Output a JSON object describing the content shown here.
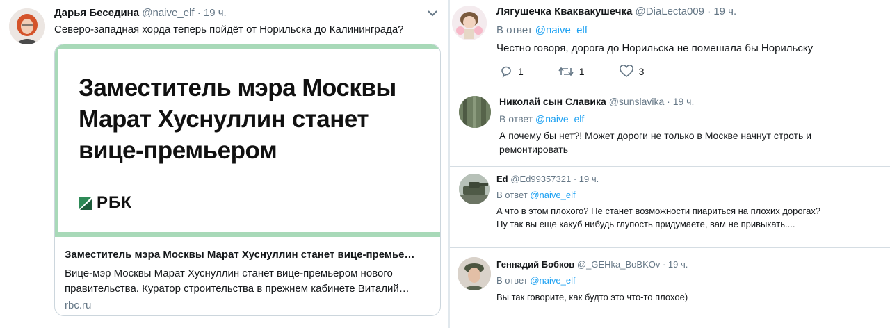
{
  "main_tweet": {
    "author_name": "Дарья Беседина",
    "handle": "@naive_elf",
    "time": "· 19 ч.",
    "text": "Северо-западная хорда теперь пойдёт от Норильска до Калининграда?",
    "card": {
      "image_headline": "Заместитель мэра Москвы Марат Хуснуллин станет вице-премьером",
      "brand": "РБК",
      "title": "Заместитель мэра Москвы Марат Хуснуллин станет вице-премье…",
      "description_line1": "Вице-мэр Москвы Марат Хуснуллин станет вице-премьером нового",
      "description_line2": "правительства. Куратор строительства в прежнем кабинете Виталий…",
      "domain": "rbc.ru"
    }
  },
  "replies": [
    {
      "author_name": "Лягушечка Кваквакушечка",
      "handle": "@DiaLecta009",
      "time": "· 19 ч.",
      "reply_to_prefix": "В ответ",
      "reply_to_handle": "@naive_elf",
      "text": "Честно говоря, дорога до Норильска не помешала бы Норильску",
      "reply_count": "1",
      "retweet_count": "1",
      "like_count": "3"
    },
    {
      "author_name": "Николай сын Славика",
      "handle": "@sunslavika",
      "time": "· 19 ч.",
      "reply_to_prefix": "В ответ",
      "reply_to_handle": "@naive_elf",
      "text_line1": "А почему бы нет?! Может дороги не только в Москве начнут строть и",
      "text_line2": "ремонтировать"
    },
    {
      "author_name": "Ed",
      "handle": "@Ed99357321",
      "time": "· 19 ч.",
      "reply_to_prefix": "В ответ",
      "reply_to_handle": "@naive_elf",
      "text_line1": "А что в этом плохого? Не станет возможности пиариться на плохих дорогах?",
      "text_line2": "Ну так вы еще какуб нибудь глупость придумаете, вам не привыкать...."
    },
    {
      "author_name": "Геннадий Бобков",
      "handle": "@_GEHka_BoBKOv",
      "time": "· 19 ч.",
      "reply_to_prefix": "В ответ",
      "reply_to_handle": "@naive_elf",
      "text": "Вы так говорите, как будто это что-то плохое)"
    }
  ],
  "icons": {
    "more": "chevron-down-icon",
    "reply": "reply-icon",
    "retweet": "retweet-icon",
    "like": "heart-icon"
  },
  "colors": {
    "link": "#1da1f2",
    "muted": "#657786",
    "card_accent": "#a8d9b8"
  }
}
